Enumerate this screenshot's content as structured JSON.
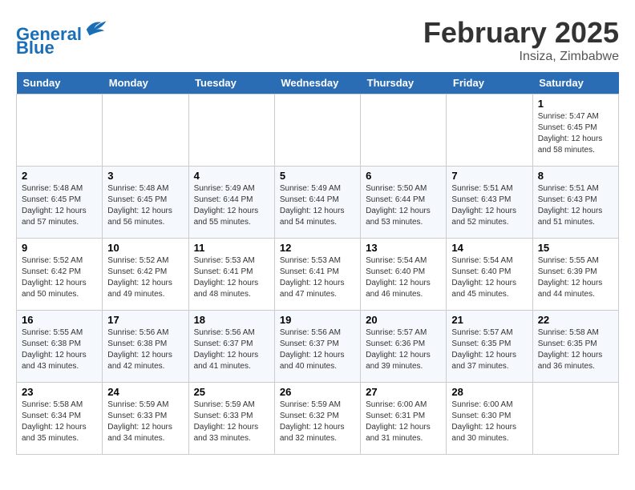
{
  "header": {
    "logo_line1": "General",
    "logo_line2": "Blue",
    "month": "February 2025",
    "location": "Insiza, Zimbabwe"
  },
  "days_of_week": [
    "Sunday",
    "Monday",
    "Tuesday",
    "Wednesday",
    "Thursday",
    "Friday",
    "Saturday"
  ],
  "weeks": [
    [
      {
        "num": "",
        "info": ""
      },
      {
        "num": "",
        "info": ""
      },
      {
        "num": "",
        "info": ""
      },
      {
        "num": "",
        "info": ""
      },
      {
        "num": "",
        "info": ""
      },
      {
        "num": "",
        "info": ""
      },
      {
        "num": "1",
        "info": "Sunrise: 5:47 AM\nSunset: 6:45 PM\nDaylight: 12 hours and 58 minutes."
      }
    ],
    [
      {
        "num": "2",
        "info": "Sunrise: 5:48 AM\nSunset: 6:45 PM\nDaylight: 12 hours and 57 minutes."
      },
      {
        "num": "3",
        "info": "Sunrise: 5:48 AM\nSunset: 6:45 PM\nDaylight: 12 hours and 56 minutes."
      },
      {
        "num": "4",
        "info": "Sunrise: 5:49 AM\nSunset: 6:44 PM\nDaylight: 12 hours and 55 minutes."
      },
      {
        "num": "5",
        "info": "Sunrise: 5:49 AM\nSunset: 6:44 PM\nDaylight: 12 hours and 54 minutes."
      },
      {
        "num": "6",
        "info": "Sunrise: 5:50 AM\nSunset: 6:44 PM\nDaylight: 12 hours and 53 minutes."
      },
      {
        "num": "7",
        "info": "Sunrise: 5:51 AM\nSunset: 6:43 PM\nDaylight: 12 hours and 52 minutes."
      },
      {
        "num": "8",
        "info": "Sunrise: 5:51 AM\nSunset: 6:43 PM\nDaylight: 12 hours and 51 minutes."
      }
    ],
    [
      {
        "num": "9",
        "info": "Sunrise: 5:52 AM\nSunset: 6:42 PM\nDaylight: 12 hours and 50 minutes."
      },
      {
        "num": "10",
        "info": "Sunrise: 5:52 AM\nSunset: 6:42 PM\nDaylight: 12 hours and 49 minutes."
      },
      {
        "num": "11",
        "info": "Sunrise: 5:53 AM\nSunset: 6:41 PM\nDaylight: 12 hours and 48 minutes."
      },
      {
        "num": "12",
        "info": "Sunrise: 5:53 AM\nSunset: 6:41 PM\nDaylight: 12 hours and 47 minutes."
      },
      {
        "num": "13",
        "info": "Sunrise: 5:54 AM\nSunset: 6:40 PM\nDaylight: 12 hours and 46 minutes."
      },
      {
        "num": "14",
        "info": "Sunrise: 5:54 AM\nSunset: 6:40 PM\nDaylight: 12 hours and 45 minutes."
      },
      {
        "num": "15",
        "info": "Sunrise: 5:55 AM\nSunset: 6:39 PM\nDaylight: 12 hours and 44 minutes."
      }
    ],
    [
      {
        "num": "16",
        "info": "Sunrise: 5:55 AM\nSunset: 6:38 PM\nDaylight: 12 hours and 43 minutes."
      },
      {
        "num": "17",
        "info": "Sunrise: 5:56 AM\nSunset: 6:38 PM\nDaylight: 12 hours and 42 minutes."
      },
      {
        "num": "18",
        "info": "Sunrise: 5:56 AM\nSunset: 6:37 PM\nDaylight: 12 hours and 41 minutes."
      },
      {
        "num": "19",
        "info": "Sunrise: 5:56 AM\nSunset: 6:37 PM\nDaylight: 12 hours and 40 minutes."
      },
      {
        "num": "20",
        "info": "Sunrise: 5:57 AM\nSunset: 6:36 PM\nDaylight: 12 hours and 39 minutes."
      },
      {
        "num": "21",
        "info": "Sunrise: 5:57 AM\nSunset: 6:35 PM\nDaylight: 12 hours and 37 minutes."
      },
      {
        "num": "22",
        "info": "Sunrise: 5:58 AM\nSunset: 6:35 PM\nDaylight: 12 hours and 36 minutes."
      }
    ],
    [
      {
        "num": "23",
        "info": "Sunrise: 5:58 AM\nSunset: 6:34 PM\nDaylight: 12 hours and 35 minutes."
      },
      {
        "num": "24",
        "info": "Sunrise: 5:59 AM\nSunset: 6:33 PM\nDaylight: 12 hours and 34 minutes."
      },
      {
        "num": "25",
        "info": "Sunrise: 5:59 AM\nSunset: 6:33 PM\nDaylight: 12 hours and 33 minutes."
      },
      {
        "num": "26",
        "info": "Sunrise: 5:59 AM\nSunset: 6:32 PM\nDaylight: 12 hours and 32 minutes."
      },
      {
        "num": "27",
        "info": "Sunrise: 6:00 AM\nSunset: 6:31 PM\nDaylight: 12 hours and 31 minutes."
      },
      {
        "num": "28",
        "info": "Sunrise: 6:00 AM\nSunset: 6:30 PM\nDaylight: 12 hours and 30 minutes."
      },
      {
        "num": "",
        "info": ""
      }
    ]
  ]
}
